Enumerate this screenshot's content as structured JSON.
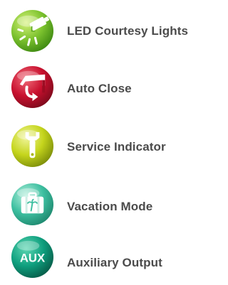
{
  "features": [
    {
      "label": "LED Courtesy Lights",
      "icon": "led-light-bulb-icon",
      "color": "#7cc22e"
    },
    {
      "label": "Auto Close",
      "icon": "auto-close-garage-door-icon",
      "color": "#c8102e"
    },
    {
      "label": "Service Indicator",
      "icon": "wrench-icon",
      "color": "#c5d51c"
    },
    {
      "label": "Vacation Mode",
      "icon": "suitcase-icon",
      "color": "#3dbfa0"
    },
    {
      "label": "Auxiliary Output",
      "icon": "aux-icon",
      "color": "#0f9f7e",
      "icon_text": "AUX"
    }
  ]
}
